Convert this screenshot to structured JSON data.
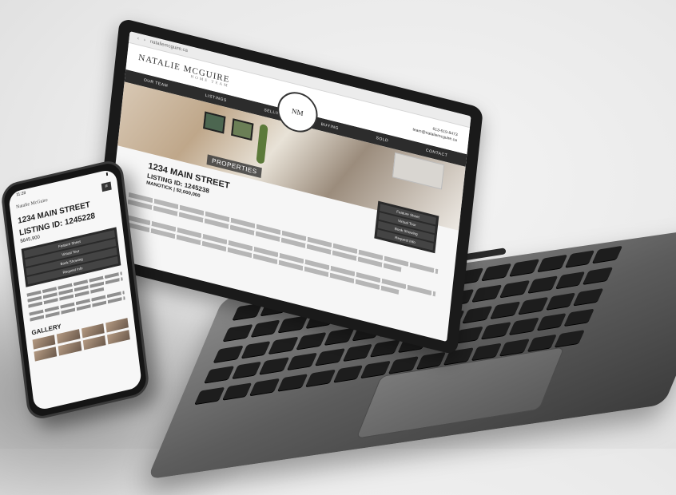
{
  "laptop": {
    "browser": {
      "url": "nataliemcguire.ca"
    },
    "site": {
      "brand": "NATALIE MCGUIRE",
      "brand_sub": "HOME TEAM",
      "logo": "NM",
      "contact": [
        "613-619-8473",
        "team@nataliemcguire.ca"
      ],
      "nav": [
        "OUR TEAM",
        "LISTINGS",
        "SELLING",
        "BUYING",
        "SOLD",
        "CONTACT"
      ]
    },
    "hero": {
      "label": "PROPERTIES"
    },
    "listing": {
      "address": "1234 MAIN STREET",
      "listing_id": "LISTING ID: 1245238",
      "location_price": "MANOTICK | $2,000,000"
    },
    "actions": [
      "Feature Sheet",
      "Virtual Tour",
      "Book Showing",
      "Request Info"
    ]
  },
  "phone": {
    "status_time": "11:28",
    "brand": "Natalie McGuire",
    "menu": "≡",
    "listing": {
      "address": "1234 MAIN STREET",
      "listing_id": "LISTING ID: 1245228",
      "price": "$645,900"
    },
    "actions": [
      "Feature Sheet",
      "Virtual Tour",
      "Book Showing",
      "Request Info"
    ],
    "gallery_title": "GALLERY"
  }
}
